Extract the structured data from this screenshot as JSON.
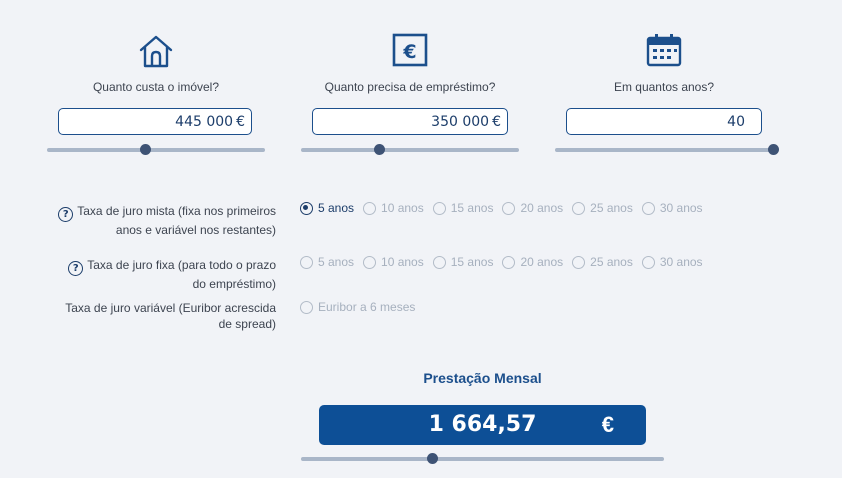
{
  "fields": [
    {
      "label": "Quanto custa o imóvel?",
      "value": "445 000",
      "currency": "€",
      "icon": "house-icon",
      "slider_fraction": 0.45
    },
    {
      "label": "Quanto precisa de empréstimo?",
      "value": "350 000",
      "currency": "€",
      "icon": "euro-icon",
      "slider_fraction": 0.36
    },
    {
      "label": "Em quantos anos?",
      "value": "40",
      "currency": "",
      "icon": "calendar-icon",
      "slider_fraction": 1.0
    }
  ],
  "rates": [
    {
      "label": "Taxa de juro mista (fixa nos primeiros anos e variável nos restantes)",
      "help": "?",
      "options": [
        "5 anos",
        "10 anos",
        "15 anos",
        "20 anos",
        "25 anos",
        "30 anos"
      ],
      "selected": 0
    },
    {
      "label": "Taxa de juro fixa (para todo o prazo do empréstimo)",
      "help": "?",
      "options": [
        "5 anos",
        "10 anos",
        "15 anos",
        "20 anos",
        "25 anos",
        "30 anos"
      ],
      "selected": -1
    },
    {
      "label": "Taxa de juro variável (Euribor acrescida de spread)",
      "help": "",
      "options": [
        "Euribor a 6 meses"
      ],
      "selected": -1
    }
  ],
  "result": {
    "title": "Prestação Mensal",
    "value": "1 664,57",
    "currency": "€",
    "slider_fraction": 0.36
  },
  "colors": {
    "accent": "#0d4f96",
    "slider_track": "#a9b6c8",
    "knob": "#3e5375",
    "background": "#f1f3f7"
  }
}
